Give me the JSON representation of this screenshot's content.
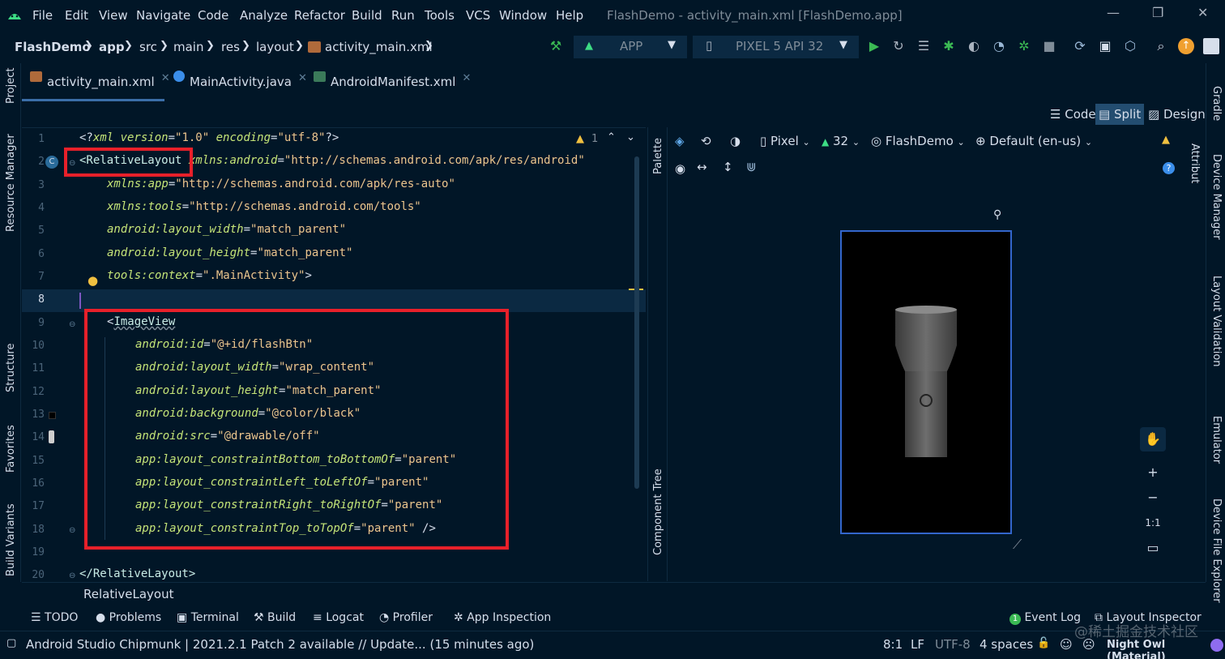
{
  "menu": {
    "items": [
      "File",
      "Edit",
      "View",
      "Navigate",
      "Code",
      "Analyze",
      "Refactor",
      "Build",
      "Run",
      "Tools",
      "VCS",
      "Window",
      "Help"
    ],
    "window_title": "FlashDemo - activity_main.xml [FlashDemo.app]"
  },
  "breadcrumb": [
    "FlashDemo",
    "app",
    "src",
    "main",
    "res",
    "layout",
    "activity_main.xml"
  ],
  "toolbar": {
    "run_config": "APP",
    "device": "PIXEL 5 API 32"
  },
  "tabs": [
    {
      "label": "activity_main.xml",
      "icon": "xml-file-icon",
      "active": true
    },
    {
      "label": "MainActivity.java",
      "icon": "java-class-icon",
      "active": false
    },
    {
      "label": "AndroidManifest.xml",
      "icon": "manifest-file-icon",
      "active": false
    }
  ],
  "view_modes": {
    "code": "Code",
    "split": "Split",
    "design": "Design",
    "selected": "Split"
  },
  "left_strip": {
    "project": "Project",
    "resource_manager": "Resource Manager",
    "structure": "Structure",
    "favorites": "Favorites",
    "build_variants": "Build Variants"
  },
  "right_strip": {
    "gradle": "Gradle",
    "device_manager": "Device Manager",
    "layout_validation": "Layout Validation",
    "emulator": "Emulator",
    "device_file_explorer": "Device File Explorer"
  },
  "attributes_label": "Attributes",
  "palette_label": "Palette",
  "component_tree_label": "Component Tree",
  "editor": {
    "warning_count": "1",
    "line_numbers": [
      "1",
      "2",
      "3",
      "4",
      "5",
      "6",
      "7",
      "8",
      "9",
      "10",
      "11",
      "12",
      "13",
      "14",
      "15",
      "16",
      "17",
      "18",
      "19",
      "20"
    ],
    "current_line": "8",
    "lines": {
      "l1a": "<?",
      "l1b": "xml version",
      "l1c": "=",
      "l1d": "\"1.0\"",
      "l1e": " encoding",
      "l1f": "=",
      "l1g": "\"utf-8\"",
      "l1h": "?>",
      "l2a": "<RelativeLayout",
      "l2b": " xmlns:android",
      "l2c": "=",
      "l2d": "\"http://schemas.android.com/apk/res/android\"",
      "l3a": "xmlns:app",
      "l3b": "=",
      "l3c": "\"http://schemas.android.com/apk/res-auto\"",
      "l4a": "xmlns:tools",
      "l4b": "=",
      "l4c": "\"http://schemas.android.com/tools\"",
      "l5a": "android:layout_width",
      "l5b": "=",
      "l5c": "\"match_parent\"",
      "l6a": "android:layout_height",
      "l6b": "=",
      "l6c": "\"match_parent\"",
      "l7a": "tools:context",
      "l7b": "=",
      "l7c": "\".MainActivity\"",
      "l7d": ">",
      "l9a": "<",
      "l9b": "ImageView",
      "l10a": "android:id",
      "l10b": "=",
      "l10c": "\"@+id/flashBtn\"",
      "l11a": "android:layout_width",
      "l11b": "=",
      "l11c": "\"wrap_content\"",
      "l12a": "android:layout_height",
      "l12b": "=",
      "l12c": "\"match_parent\"",
      "l13a": "android:background",
      "l13b": "=",
      "l13c": "\"@color/black\"",
      "l14a": "android:src",
      "l14b": "=",
      "l14c": "\"@drawable/off\"",
      "l15a": "app:layout_constraintBottom_toBottomOf",
      "l15b": "=",
      "l15c": "\"parent\"",
      "l16a": "app:layout_constraintLeft_toLeftOf",
      "l16b": "=",
      "l16c": "\"parent\"",
      "l17a": "app:layout_constraintRight_toRightOf",
      "l17b": "=",
      "l17c": "\"parent\"",
      "l18a": "app:layout_constraintTop_toTopOf",
      "l18b": "=",
      "l18c": "\"parent\"",
      "l18d": " />",
      "l20a": "</RelativeLayout>"
    }
  },
  "design_toolbar": {
    "device": "Pixel",
    "api": "32",
    "theme": "FlashDemo",
    "locale": "Default (en-us)"
  },
  "zoom": {
    "plus": "+",
    "minus": "−",
    "fit": "1:1"
  },
  "breadcrumb_bottom": "RelativeLayout",
  "tool_windows": [
    "TODO",
    "Problems",
    "Terminal",
    "Build",
    "Logcat",
    "Profiler",
    "App Inspection",
    "Event Log",
    "Layout Inspector"
  ],
  "event_log_count": "1",
  "status": {
    "message": "Android Studio Chipmunk | 2021.2.1 Patch 2 available // Update... (15 minutes ago)",
    "position": "8:1",
    "line_sep": "LF",
    "encoding": "UTF-8",
    "indent": "4 spaces",
    "theme": "Night Owl (Material)",
    "watermark": "@稀土掘金技术社区"
  },
  "colors": {
    "background": "#011627",
    "accent": "#3b6ea8",
    "highlight_red": "#e8202a",
    "run_green": "#3bba54"
  }
}
